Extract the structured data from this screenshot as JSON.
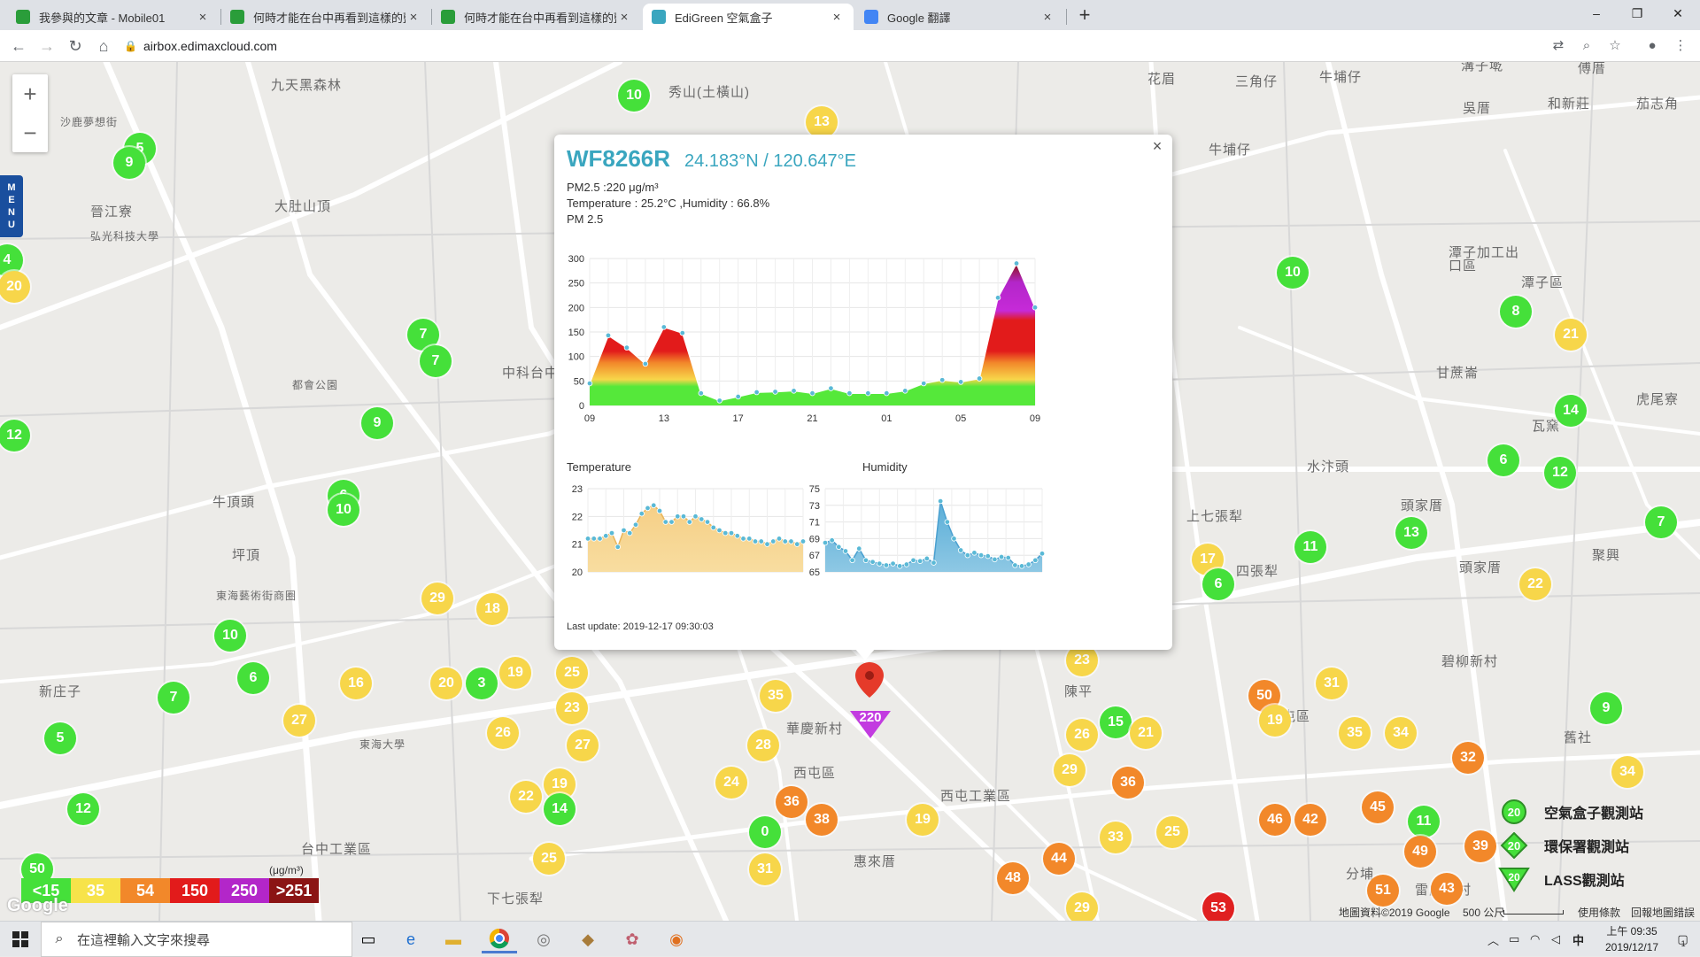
{
  "browser": {
    "tabs": [
      {
        "title": "我參與的文章 - Mobile01",
        "favicon_color": "#2a9d3a",
        "active": false
      },
      {
        "title": "何時才能在台中再看到這樣的藍天",
        "favicon_color": "#2a9d3a",
        "active": false
      },
      {
        "title": "何時才能在台中再看到這樣的藍天",
        "favicon_color": "#2a9d3a",
        "active": false
      },
      {
        "title": "EdiGreen 空氣盒子",
        "favicon_color": "#3aa6bf",
        "active": true
      },
      {
        "title": "Google 翻譯",
        "favicon_color": "#4285f4",
        "active": false
      }
    ],
    "tab_close_glyph": "×",
    "new_tab_glyph": "+",
    "url": "airbox.edimaxcloud.com",
    "window_controls": [
      "–",
      "❐",
      "✕"
    ]
  },
  "map": {
    "place_labels": [
      {
        "text": "九天黑森林"
      },
      {
        "text": "秀山(土橫山)"
      },
      {
        "text": "花眉"
      },
      {
        "text": "三角仔"
      },
      {
        "text": "牛埔仔"
      },
      {
        "text": "溝子墘"
      },
      {
        "text": "傅厝"
      },
      {
        "text": "沙鹿夢想街"
      },
      {
        "text": "吳厝"
      },
      {
        "text": "和新莊"
      },
      {
        "text": "茄志角"
      },
      {
        "text": "晉江寮"
      },
      {
        "text": "大肚山頂"
      },
      {
        "text": "弘光科技大學"
      },
      {
        "text": "牛埔仔"
      },
      {
        "text": "潭子加工出口區"
      },
      {
        "text": "潭子區"
      },
      {
        "text": "都會公園"
      },
      {
        "text": "中科台中"
      },
      {
        "text": "甘蔗崙"
      },
      {
        "text": "虎尾寮"
      },
      {
        "text": "瓦窯"
      },
      {
        "text": "水汴頭"
      },
      {
        "text": "上七張犁"
      },
      {
        "text": "頭家厝"
      },
      {
        "text": "牛頂頭"
      },
      {
        "text": "坪頂"
      },
      {
        "text": "四張犁"
      },
      {
        "text": "頭家厝"
      },
      {
        "text": "聚興"
      },
      {
        "text": "東海藝術街商圈"
      },
      {
        "text": "新庄子"
      },
      {
        "text": "東海大學"
      },
      {
        "text": "華慶新村"
      },
      {
        "text": "西屯區"
      },
      {
        "text": "陳平"
      },
      {
        "text": "北屯區"
      },
      {
        "text": "碧柳新村"
      },
      {
        "text": "西屯工業區"
      },
      {
        "text": "惠來厝"
      },
      {
        "text": "台中工業區"
      },
      {
        "text": "下七張犁"
      },
      {
        "text": "分埔"
      },
      {
        "text": "雷虎新村"
      },
      {
        "text": "舊社"
      }
    ],
    "zoom_in": "+",
    "zoom_out": "−",
    "menu_label": "MENU",
    "markers": [
      {
        "value": "10",
        "level": "green"
      },
      {
        "value": "13",
        "level": "yellow"
      },
      {
        "value": "5",
        "level": "green"
      },
      {
        "value": "9",
        "level": "green"
      },
      {
        "value": "4",
        "level": "green"
      },
      {
        "value": "20",
        "level": "yellow"
      },
      {
        "value": "7",
        "level": "green"
      },
      {
        "value": "7",
        "level": "green"
      },
      {
        "value": "9",
        "level": "green"
      },
      {
        "value": "12",
        "level": "green"
      },
      {
        "value": "6",
        "level": "green"
      },
      {
        "value": "10",
        "level": "green"
      },
      {
        "value": "29",
        "level": "yellow"
      },
      {
        "value": "18",
        "level": "yellow"
      },
      {
        "value": "10",
        "level": "green"
      },
      {
        "value": "6",
        "level": "green"
      },
      {
        "value": "7",
        "level": "green"
      },
      {
        "value": "5",
        "level": "green"
      },
      {
        "value": "16",
        "level": "yellow"
      },
      {
        "value": "27",
        "level": "yellow"
      },
      {
        "value": "20",
        "level": "yellow"
      },
      {
        "value": "3",
        "level": "green"
      },
      {
        "value": "19",
        "level": "yellow"
      },
      {
        "value": "25",
        "level": "yellow"
      },
      {
        "value": "23",
        "level": "yellow"
      },
      {
        "value": "26",
        "level": "yellow"
      },
      {
        "value": "27",
        "level": "yellow"
      },
      {
        "value": "22",
        "level": "yellow"
      },
      {
        "value": "19",
        "level": "yellow"
      },
      {
        "value": "14",
        "level": "green"
      },
      {
        "value": "12",
        "level": "green"
      },
      {
        "value": "25",
        "level": "yellow"
      },
      {
        "value": "35",
        "level": "yellow"
      },
      {
        "value": "28",
        "level": "yellow"
      },
      {
        "value": "24",
        "level": "yellow"
      },
      {
        "value": "36",
        "level": "orange"
      },
      {
        "value": "38",
        "level": "orange"
      },
      {
        "value": "0",
        "level": "green"
      },
      {
        "value": "31",
        "level": "yellow"
      },
      {
        "value": "19",
        "level": "yellow"
      },
      {
        "value": "23",
        "level": "yellow"
      },
      {
        "value": "26",
        "level": "yellow"
      },
      {
        "value": "15",
        "level": "green"
      },
      {
        "value": "21",
        "level": "yellow"
      },
      {
        "value": "29",
        "level": "yellow"
      },
      {
        "value": "36",
        "level": "orange"
      },
      {
        "value": "33",
        "level": "yellow"
      },
      {
        "value": "25",
        "level": "yellow"
      },
      {
        "value": "44",
        "level": "orange"
      },
      {
        "value": "48",
        "level": "orange"
      },
      {
        "value": "29",
        "level": "yellow"
      },
      {
        "value": "53",
        "level": "red"
      },
      {
        "value": "10",
        "level": "green"
      },
      {
        "value": "8",
        "level": "green"
      },
      {
        "value": "21",
        "level": "yellow"
      },
      {
        "value": "14",
        "level": "green"
      },
      {
        "value": "6",
        "level": "green"
      },
      {
        "value": "12",
        "level": "green"
      },
      {
        "value": "13",
        "level": "green"
      },
      {
        "value": "11",
        "level": "green"
      },
      {
        "value": "7",
        "level": "green"
      },
      {
        "value": "17",
        "level": "yellow"
      },
      {
        "value": "6",
        "level": "green"
      },
      {
        "value": "22",
        "level": "yellow"
      },
      {
        "value": "50",
        "level": "orange"
      },
      {
        "value": "31",
        "level": "yellow"
      },
      {
        "value": "19",
        "level": "yellow"
      },
      {
        "value": "35",
        "level": "yellow"
      },
      {
        "value": "34",
        "level": "yellow"
      },
      {
        "value": "32",
        "level": "orange"
      },
      {
        "value": "9",
        "level": "green"
      },
      {
        "value": "34",
        "level": "yellow"
      },
      {
        "value": "46",
        "level": "orange"
      },
      {
        "value": "42",
        "level": "orange"
      },
      {
        "value": "45",
        "level": "orange"
      },
      {
        "value": "11",
        "level": "green"
      },
      {
        "value": "49",
        "level": "orange"
      },
      {
        "value": "39",
        "level": "orange"
      },
      {
        "value": "51",
        "level": "orange"
      },
      {
        "value": "43",
        "level": "orange"
      },
      {
        "value": "50",
        "level": "green"
      }
    ],
    "selected_value": "220",
    "aqi_legend": [
      {
        "label": "<15",
        "color": "#45e03a"
      },
      {
        "label": "35",
        "color": "#f7e34a"
      },
      {
        "label": "54",
        "color": "#f2882a"
      },
      {
        "label": "150",
        "color": "#e21b1b"
      },
      {
        "label": "250",
        "color": "#b326c9"
      },
      {
        "label": ">251",
        "color": "#8b1414"
      }
    ],
    "aqi_unit": "(μg/m³)",
    "google_logo": "Google",
    "station_types": [
      {
        "label": "空氣盒子觀測站",
        "value": "20"
      },
      {
        "label": "環保署觀測站",
        "value": "20"
      },
      {
        "label": "LASS觀測站",
        "value": "20"
      }
    ],
    "footer": {
      "copyright": "地圖資料©2019 Google",
      "scale": "500 公尺",
      "terms": "使用條款",
      "report": "回報地圖錯誤"
    }
  },
  "popup": {
    "close_glyph": "×",
    "station": "WF8266R",
    "coords": "24.183°N / 120.647°E",
    "pm25_line": "PM2.5 :220 μg/m³",
    "temp_hum_line": "Temperature : 25.2°C ,Humidity : 66.8%",
    "pm_chart_title": "PM 2.5",
    "temperature_title": "Temperature",
    "humidity_title": "Humidity",
    "last_update": "Last update: 2019-12-17 09:30:03"
  },
  "chart_data": [
    {
      "type": "area",
      "title": "PM 2.5",
      "categories": [
        "09",
        "13",
        "17",
        "21",
        "01",
        "05",
        "09"
      ],
      "x": [
        0,
        1,
        2,
        3,
        4,
        5,
        6,
        7,
        8,
        9,
        10,
        11,
        12,
        13,
        14,
        15,
        16,
        17,
        18,
        19,
        20,
        21,
        22,
        23,
        24
      ],
      "values": [
        45,
        143,
        118,
        85,
        160,
        148,
        25,
        10,
        18,
        27,
        28,
        30,
        25,
        35,
        25,
        25,
        25,
        30,
        45,
        52,
        48,
        55,
        220,
        290,
        200
      ],
      "ylim": [
        0,
        300
      ],
      "yticks": [
        0,
        50,
        100,
        150,
        200,
        250,
        300
      ]
    },
    {
      "type": "area",
      "title": "Temperature",
      "x": [
        0,
        1,
        2,
        3,
        4,
        5,
        6,
        7,
        8,
        9,
        10,
        11,
        12,
        13,
        14,
        15,
        16,
        17,
        18,
        19,
        20,
        21,
        22,
        23,
        24,
        25,
        26,
        27,
        28,
        29,
        30,
        31,
        32,
        33,
        34,
        35,
        36
      ],
      "values": [
        21.2,
        21.2,
        21.2,
        21.3,
        21.4,
        20.9,
        21.5,
        21.4,
        21.7,
        22.1,
        22.3,
        22.4,
        22.2,
        21.8,
        21.8,
        22.0,
        22.0,
        21.8,
        22.0,
        21.9,
        21.8,
        21.6,
        21.5,
        21.4,
        21.4,
        21.3,
        21.2,
        21.2,
        21.1,
        21.1,
        21.0,
        21.1,
        21.2,
        21.1,
        21.1,
        21.0,
        21.1
      ],
      "ylim": [
        20,
        23
      ],
      "yticks": [
        20,
        21,
        22,
        23
      ]
    },
    {
      "type": "area",
      "title": "Humidity",
      "x": [
        0,
        1,
        2,
        3,
        4,
        5,
        6,
        7,
        8,
        9,
        10,
        11,
        12,
        13,
        14,
        15,
        16,
        17,
        18,
        19,
        20,
        21,
        22,
        23,
        24,
        25,
        26,
        27,
        28,
        29,
        30,
        31,
        32
      ],
      "values": [
        68.5,
        68.8,
        68.0,
        67.5,
        66.4,
        67.8,
        66.4,
        66.2,
        66.0,
        65.8,
        66.0,
        65.7,
        65.9,
        66.4,
        66.3,
        66.6,
        66.1,
        73.5,
        71.0,
        69.0,
        67.6,
        67.0,
        67.3,
        67.0,
        66.9,
        66.5,
        66.8,
        66.7,
        65.8,
        65.7,
        65.9,
        66.4,
        67.2
      ],
      "ylim": [
        65,
        75
      ],
      "yticks": [
        65,
        67,
        69,
        71,
        73,
        75
      ]
    }
  ],
  "taskbar": {
    "search_placeholder": "在這裡輸入文字來搜尋",
    "input_indicator": "中",
    "time": "上午 09:35",
    "date": "2019/12/17",
    "notification_count": "1"
  }
}
